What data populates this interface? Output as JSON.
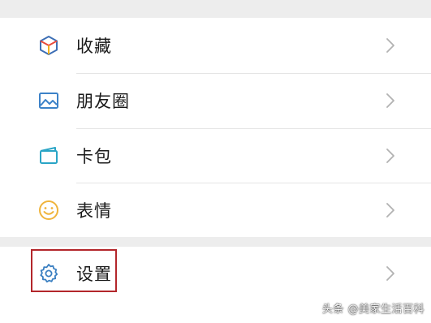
{
  "menu": {
    "items": [
      {
        "label": "收藏",
        "icon": "favorites-cube-icon"
      },
      {
        "label": "朋友圈",
        "icon": "moments-image-icon"
      },
      {
        "label": "卡包",
        "icon": "card-wallet-icon"
      },
      {
        "label": "表情",
        "icon": "sticker-smiley-icon"
      }
    ]
  },
  "settings": {
    "label": "设置",
    "icon": "settings-gear-icon"
  },
  "chevron_icon": "chevron-right-icon",
  "highlight_color": "#b3262b",
  "watermark": "头条 @美家生活百科"
}
